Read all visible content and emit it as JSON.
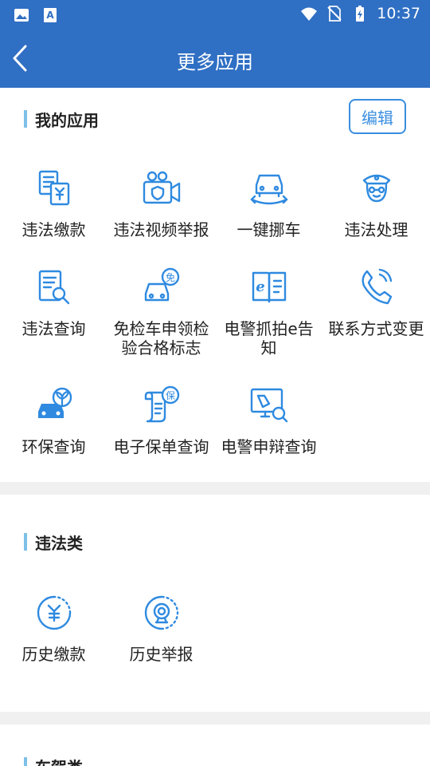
{
  "status_bar": {
    "time": "10:37"
  },
  "app_bar": {
    "title": "更多应用"
  },
  "my_apps": {
    "title": "我的应用",
    "edit_label": "编辑",
    "items": [
      {
        "label": "违法缴款",
        "icon": "violation-payment-icon"
      },
      {
        "label": "违法视频举报",
        "icon": "video-report-icon"
      },
      {
        "label": "一键挪车",
        "icon": "move-car-icon"
      },
      {
        "label": "违法处理",
        "icon": "police-icon"
      },
      {
        "label": "违法查询",
        "icon": "violation-query-icon"
      },
      {
        "label": "免检车申领检验合格标志",
        "icon": "exempt-car-icon"
      },
      {
        "label": "电警抓拍e告知",
        "icon": "e-notify-icon"
      },
      {
        "label": "联系方式变更",
        "icon": "phone-change-icon"
      },
      {
        "label": "环保查询",
        "icon": "eco-query-icon"
      },
      {
        "label": "电子保单查询",
        "icon": "insurance-query-icon"
      },
      {
        "label": "电警申辩查询",
        "icon": "appeal-query-icon"
      }
    ]
  },
  "violations": {
    "title": "违法类",
    "items": [
      {
        "label": "历史缴款",
        "icon": "history-payment-icon"
      },
      {
        "label": "历史举报",
        "icon": "history-report-icon"
      }
    ]
  },
  "next_section": {
    "title": "车驾类"
  },
  "colors": {
    "primary": "#2f6fc4",
    "accent": "#3a8ee0",
    "icon": "#2f8ae0"
  }
}
